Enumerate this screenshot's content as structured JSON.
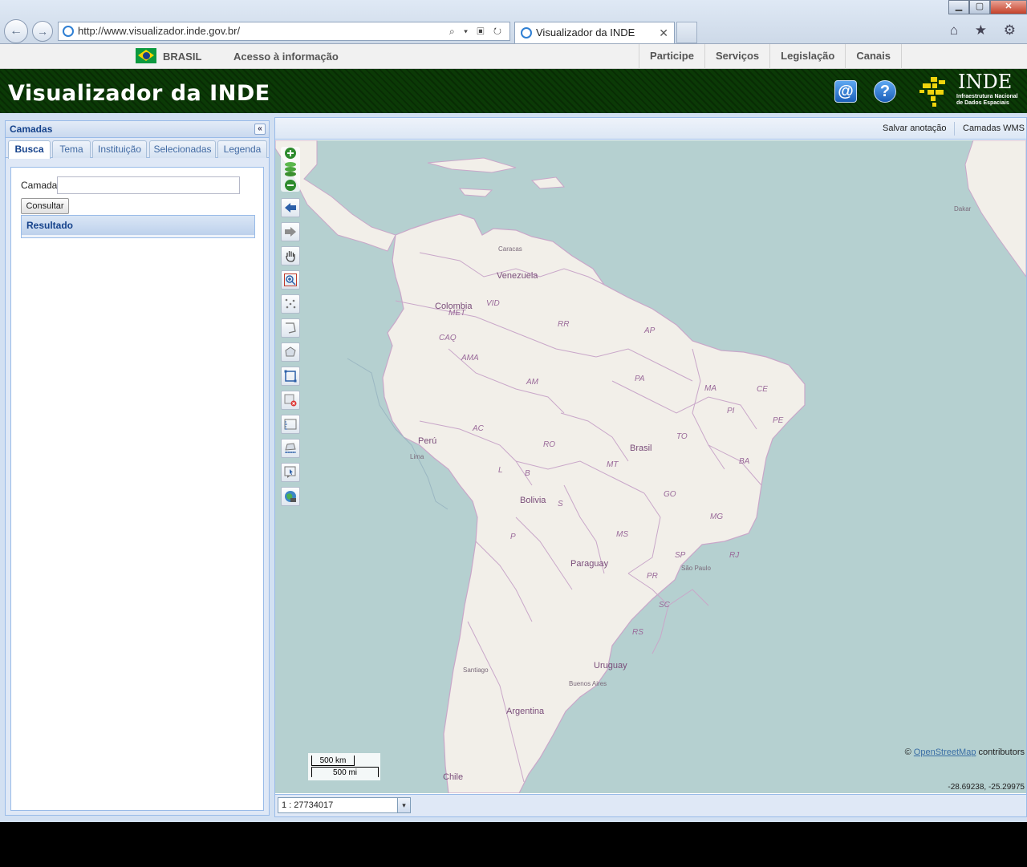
{
  "browser": {
    "url": "http://www.visualizador.inde.gov.br/",
    "tab_title": "Visualizador da INDE",
    "tab_close": "✕",
    "back_glyph": "←",
    "forward_glyph": "→",
    "address_tools": "⌕ ▾ ▣ ↻",
    "right_icons": "⌂ ★ ⚙",
    "window_buttons": {
      "minimize": "▁",
      "maximize": "▢",
      "close": "✕"
    }
  },
  "govbar": {
    "country": "BRASIL",
    "acesso": "Acesso à informação",
    "nav": [
      "Participe",
      "Serviços",
      "Legislação",
      "Canais"
    ]
  },
  "header": {
    "title": "Visualizador da INDE",
    "email_icon": "@",
    "help_icon": "?",
    "logo_word": "INDE",
    "logo_sub_1": "Infraestrutura Nacional",
    "logo_sub_2": "de Dados Espaciais",
    "colors": {
      "header_bg": "#0b3a06",
      "logo_yellow": "#f1d40d"
    }
  },
  "panel": {
    "title": "Camadas",
    "collapse_glyph": "«",
    "tabs": [
      "Busca",
      "Tema",
      "Instituição",
      "Selecionadas",
      "Legenda"
    ],
    "active_tab": "Busca",
    "camada_label": "Camada:",
    "camada_value": "",
    "consultar_label": "Consultar",
    "resultado_label": "Resultado"
  },
  "map": {
    "toolbar": {
      "save_annotation": "Salvar anotação",
      "wms_layers": "Camadas WMS"
    },
    "tools": [
      "zoom-in",
      "zoom-slider",
      "zoom-out",
      "previous-extent",
      "next-extent",
      "pan",
      "zoom-box",
      "draw-point",
      "draw-line",
      "draw-polygon",
      "select-box",
      "delete-feature",
      "measure-distance",
      "measure-area",
      "identify",
      "print"
    ],
    "labels": {
      "countries": [
        "Venezuela",
        "Colombia",
        "Perú",
        "Bolivia",
        "Brasil",
        "Paraguay",
        "Uruguay",
        "Argentina",
        "Chile"
      ],
      "cities": [
        "Caracas",
        "Lima",
        "Santiago",
        "Buenos Aires",
        "São Paulo",
        "Dakar"
      ],
      "states": [
        "VID",
        "MET",
        "CAQ",
        "AMA",
        "RR",
        "AP",
        "AM",
        "PA",
        "MA",
        "CE",
        "PI",
        "PE",
        "AC",
        "RO",
        "TO",
        "BA",
        "MT",
        "GO",
        "MG",
        "B",
        "S",
        "L",
        "P",
        "MS",
        "SP",
        "RJ",
        "PR",
        "SC",
        "RS"
      ]
    },
    "scalebar_km": "500 km",
    "scalebar_mi": "500 mi",
    "attribution_prefix": "©",
    "attribution_link": "OpenStreetMap",
    "attribution_suffix": "contributors",
    "coords": "-28.69238, -25.29975",
    "scale_value": "1 : 27734017",
    "scale_dropdown_glyph": "▾"
  }
}
